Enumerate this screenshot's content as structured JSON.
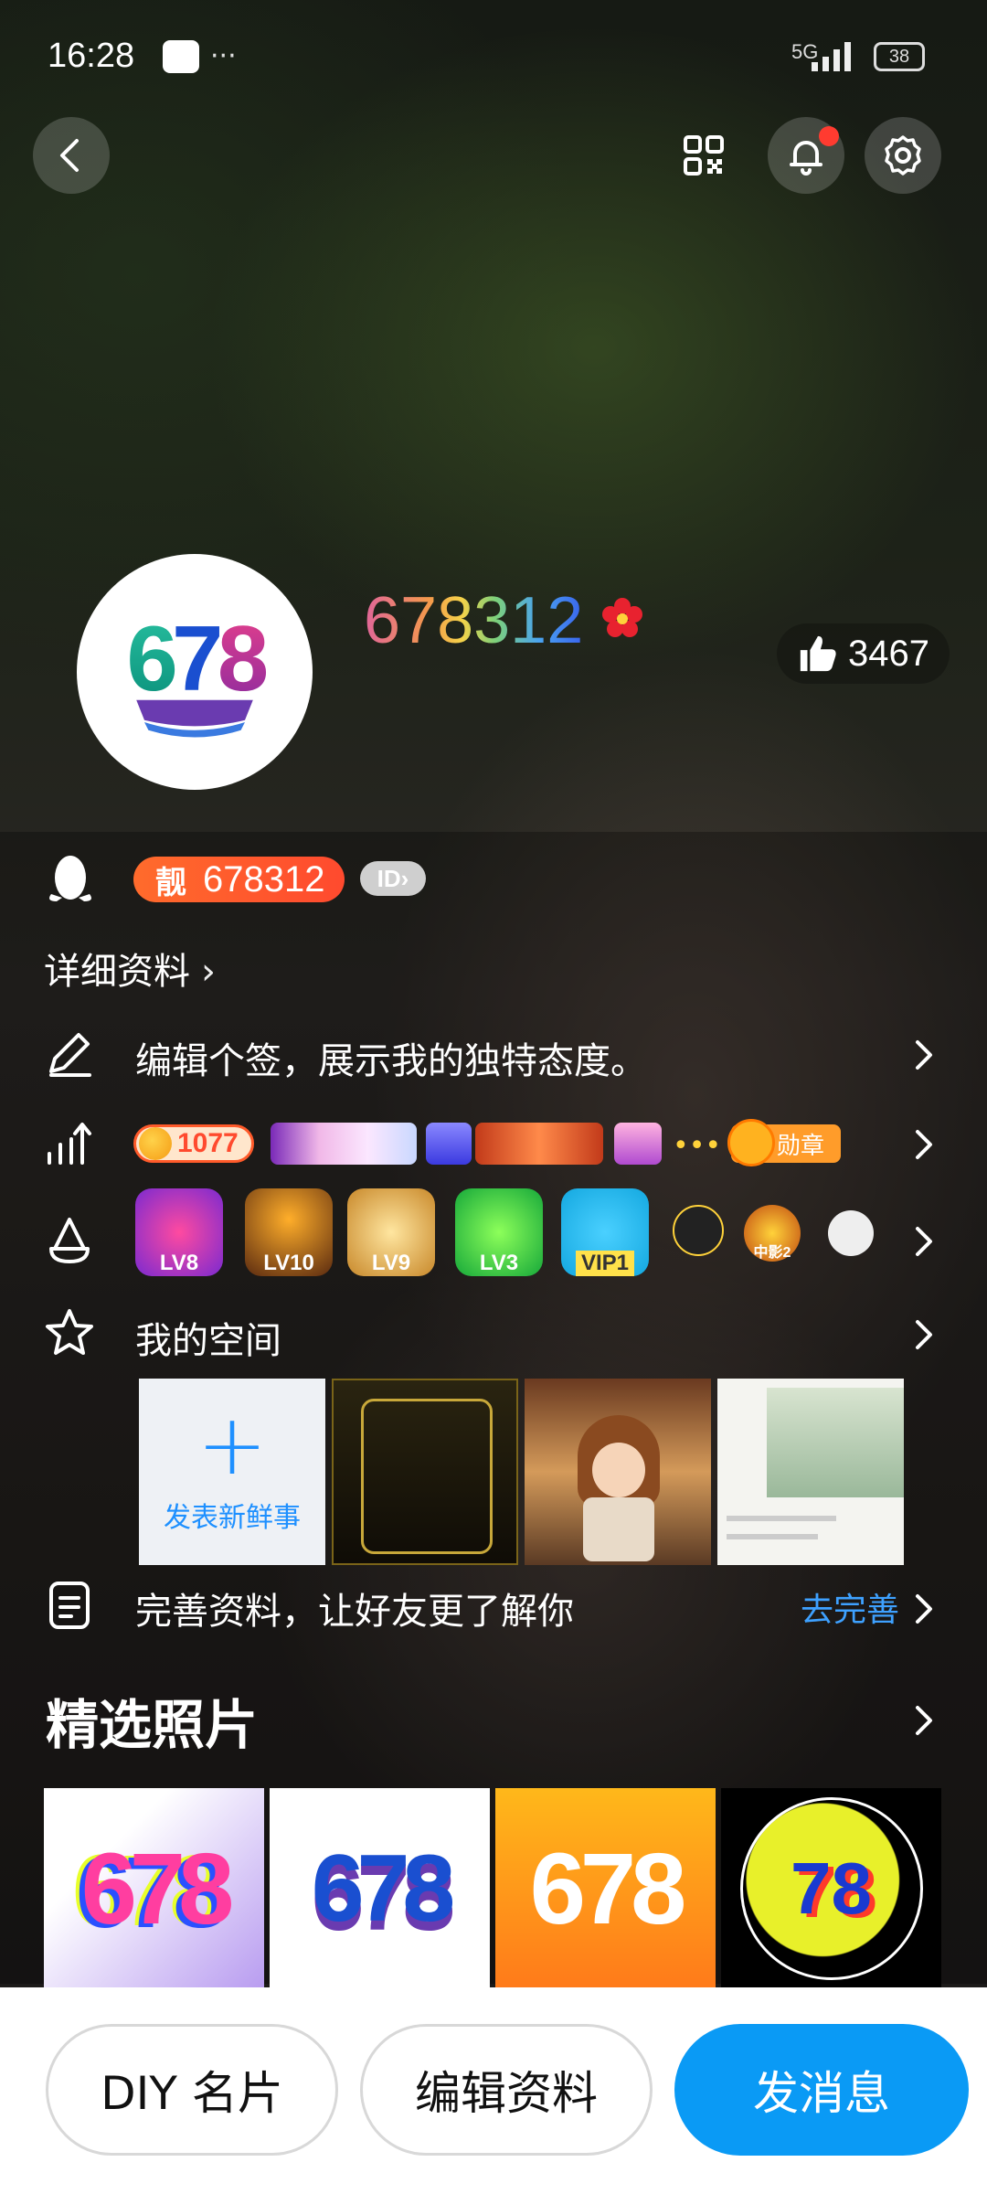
{
  "status_bar": {
    "time": "16:28",
    "network": "5G",
    "battery": "38"
  },
  "header": {
    "nickname": "678312",
    "likes": "3467",
    "avatar_logo": "678"
  },
  "account": {
    "liang_label": "靓",
    "qq_number": "678312",
    "id_badge": "ID",
    "detail_link": "详细资料"
  },
  "rows": {
    "signature": "编辑个签，展示我的独特态度。",
    "level_coin": "1077",
    "medal_label": "勋章",
    "game_badges": [
      "LV8",
      "LV10",
      "LV9",
      "LV3",
      "VIP1",
      "",
      "中影2",
      ""
    ],
    "my_space": "我的空间",
    "post_new": "发表新鲜事",
    "complete_profile": "完善资料，让好友更了解你",
    "go_complete": "去完善"
  },
  "featured": {
    "title": "精选照片",
    "photos": [
      "678",
      "678",
      "678",
      "78"
    ]
  },
  "bottom_bar": {
    "diy_card": "DIY 名片",
    "edit_profile": "编辑资料",
    "send_message": "发消息"
  },
  "colors": {
    "accent": "#0a9af5",
    "liang": "#ff5a2e",
    "link": "#3ea1ff",
    "badge_red": "#ff3b30"
  }
}
